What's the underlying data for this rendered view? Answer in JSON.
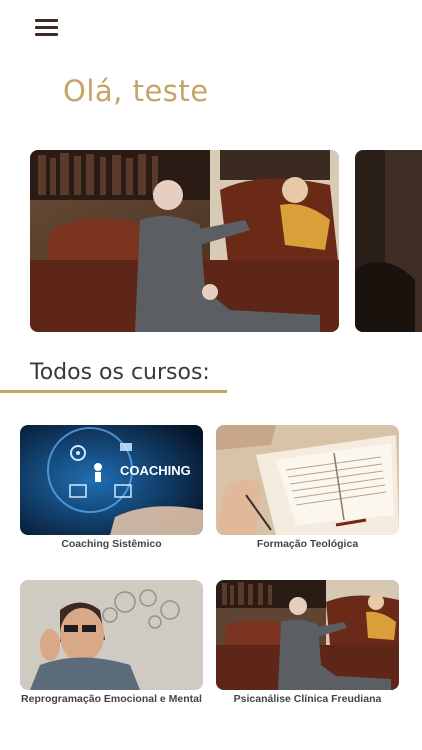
{
  "header": {
    "menu_icon": "hamburger-menu-icon",
    "greeting": "Olá, teste"
  },
  "carousel": {
    "slides": [
      {
        "image": "psychoanalysis-session-photo"
      },
      {
        "image": "dark-office-photo"
      }
    ]
  },
  "courses_section": {
    "title": "Todos os cursos:",
    "accent_color": "#c4a567",
    "courses": [
      {
        "title": "Coaching Sistêmico",
        "image": "coaching-photo",
        "image_text": "COACHING"
      },
      {
        "title": "Formação Teológica",
        "image": "bible-reading-photo"
      },
      {
        "title": "Reprogramação Emocional e Mental",
        "image": "thinking-man-photo"
      },
      {
        "title": "Psicanálise Clínica Freudiana",
        "image": "psychoanalysis-session-photo"
      }
    ]
  }
}
